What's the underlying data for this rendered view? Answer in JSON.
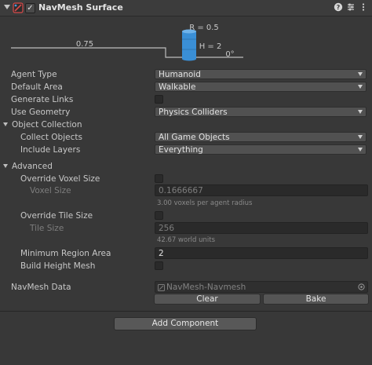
{
  "header": {
    "title": "NavMesh Surface",
    "enabled": true,
    "icons": [
      "navmesh-surface-icon",
      "help-icon",
      "preset-icon",
      "more-options-icon"
    ]
  },
  "agent_diagram": {
    "radius_label": "R = 0.5",
    "height_label": "H = 2",
    "step_label": "0.75",
    "slope_label": "0°",
    "cylinder_color": "#3a8fd6"
  },
  "fields": {
    "agent_type": {
      "label": "Agent Type",
      "value": "Humanoid"
    },
    "default_area": {
      "label": "Default Area",
      "value": "Walkable"
    },
    "generate_links": {
      "label": "Generate Links",
      "checked": false
    },
    "use_geometry": {
      "label": "Use Geometry",
      "value": "Physics Colliders"
    }
  },
  "object_collection": {
    "label": "Object Collection",
    "collect_objects": {
      "label": "Collect Objects",
      "value": "All Game Objects"
    },
    "include_layers": {
      "label": "Include Layers",
      "value": "Everything"
    }
  },
  "advanced": {
    "label": "Advanced",
    "override_voxel_size": {
      "label": "Override Voxel Size",
      "checked": false
    },
    "voxel_size": {
      "label": "Voxel Size",
      "value": "0.1666667",
      "hint": "3.00 voxels per agent radius"
    },
    "override_tile_size": {
      "label": "Override Tile Size",
      "checked": false
    },
    "tile_size": {
      "label": "Tile Size",
      "value": "256",
      "hint": "42.67 world units"
    },
    "min_region_area": {
      "label": "Minimum Region Area",
      "value": "2"
    },
    "build_height_mesh": {
      "label": "Build Height Mesh",
      "checked": false
    }
  },
  "navmesh_data": {
    "label": "NavMesh Data",
    "value": "NavMesh-Navmesh",
    "clear_label": "Clear",
    "bake_label": "Bake"
  },
  "add_component_label": "Add Component"
}
